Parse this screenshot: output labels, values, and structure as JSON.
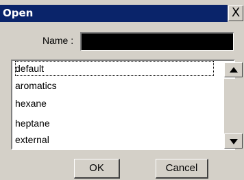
{
  "dialog": {
    "title": "Open",
    "close_label": "X",
    "name_label": "Name :",
    "name_value": ""
  },
  "list": {
    "items": [
      "default",
      "aromatics",
      "hexane",
      "heptane",
      "external"
    ],
    "focused_index": 0
  },
  "scrollbar": {
    "up_icon": "arrow-up-icon",
    "down_icon": "arrow-down-icon"
  },
  "buttons": {
    "ok": "OK",
    "cancel": "Cancel"
  },
  "colors": {
    "title_bar": "#0a246a",
    "face": "#d4d0c8",
    "name_field": "#000000"
  }
}
